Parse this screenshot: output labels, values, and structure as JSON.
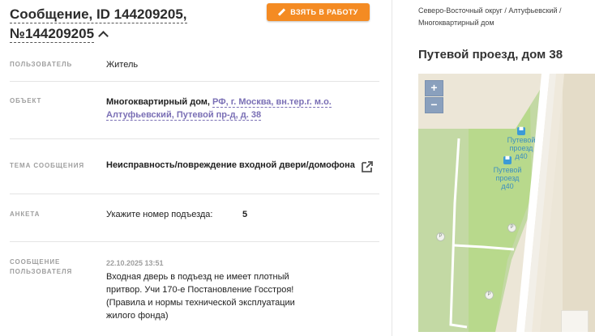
{
  "header": {
    "title_line1": "Сообщение, ID 144209205,",
    "title_line2": "№144209205",
    "work_button": "ВЗЯТЬ В РАБОТУ"
  },
  "fields": {
    "user": {
      "label": "ПОЛЬЗОВАТЕЛЬ",
      "value": "Житель"
    },
    "object": {
      "label": "ОБЪЕКТ",
      "type": "Многоквартирный дом,",
      "address_line1": "РФ, г. Москва, вн.тер.г. м.о.",
      "address_line2": "Алтуфьевский, Путевой пр-д, д. 38"
    },
    "topic": {
      "label": "ТЕМА СООБЩЕНИЯ",
      "value": "Неисправность/повреждение входной двери/домофона"
    },
    "survey": {
      "label": "АНКЕТА",
      "question": "Укажите номер подъезда:",
      "answer": "5"
    },
    "message": {
      "label_line1": "СООБЩЕНИЕ",
      "label_line2": "ПОЛЬЗОВАТЕЛЯ",
      "date": "22.10.2025 13:51",
      "lines": [
        "Входная дверь в подъезд не имеет плотный",
        "притвор. Учи 170-е Постановление Госстроя!",
        "(Правила и нормы технической эксплуатации",
        "жилого фонда)"
      ]
    }
  },
  "side": {
    "breadcrumb_line1": "Северо-Восточный округ / Алтуфьевский /",
    "breadcrumb_line2": "Многоквартирный дом",
    "place_title": "Путевой проезд, дом 38"
  },
  "map": {
    "zoom_in": "+",
    "zoom_out": "−",
    "stop1_line1": "Путевой проезд",
    "stop1_line2": "д40",
    "stop2_line1": "Путевой проезд",
    "stop2_line2": "д40",
    "parking_symbol": "P",
    "bus_symbol": "▀"
  },
  "colors": {
    "accent_orange": "#f48b23",
    "link_purple": "#7a6fb5",
    "label_grey": "#9e9e9e"
  }
}
